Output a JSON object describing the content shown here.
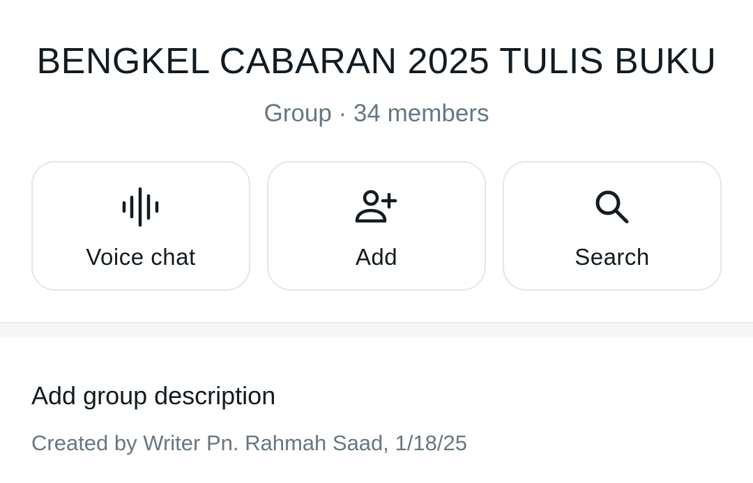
{
  "group": {
    "title": "BENGKEL CABARAN 2025 TULIS BUKU",
    "meta": "Group · 34 members"
  },
  "actions": {
    "voice_chat": {
      "label": "Voice chat",
      "icon": "voice-chat-icon"
    },
    "add": {
      "label": "Add",
      "icon": "add-person-icon"
    },
    "search": {
      "label": "Search",
      "icon": "search-icon"
    }
  },
  "description": {
    "add_label": "Add group description",
    "created_by": "Created by Writer Pn. Rahmah Saad, 1/18/25"
  },
  "colors": {
    "text_primary": "#111b21",
    "text_secondary": "#667781",
    "divider": "#f6f7f8",
    "button_border": "#e4e6e8"
  }
}
